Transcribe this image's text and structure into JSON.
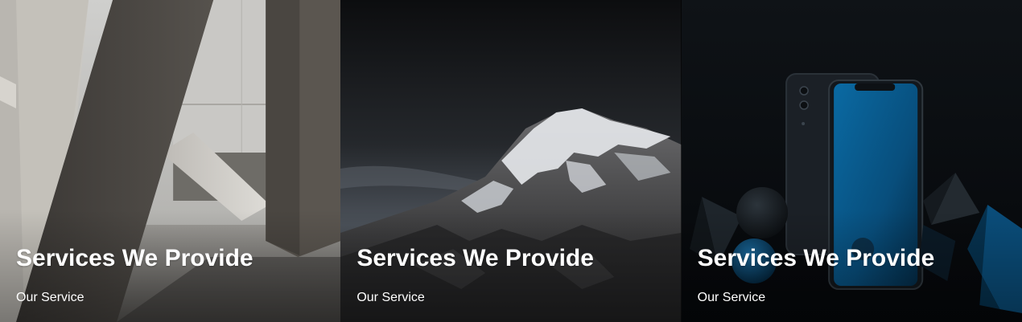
{
  "cards": [
    {
      "title": "Services We Provide",
      "subtitle": "Our Service",
      "image": "concrete-architecture-photo"
    },
    {
      "title": "Services We Provide",
      "subtitle": "Our Service",
      "image": "snowy-mountain-photo"
    },
    {
      "title": "Services We Provide",
      "subtitle": "Our Service",
      "image": "smartphones-dark-render-photo"
    }
  ],
  "colors": {
    "text": "#ffffff",
    "accent_blue": "#0a5a8c"
  }
}
